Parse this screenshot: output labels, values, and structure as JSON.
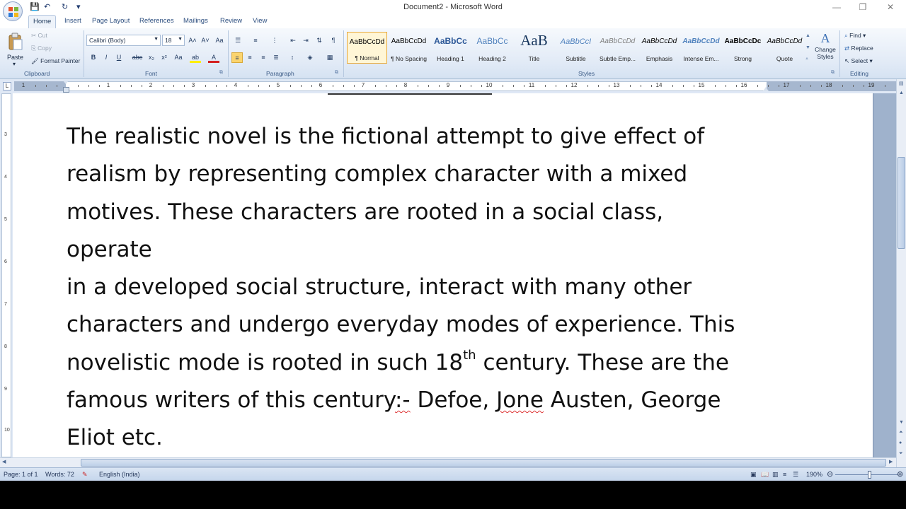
{
  "window": {
    "title": "Document2 - Microsoft Word",
    "controls": {
      "minimize": "—",
      "restore": "❐",
      "close": "✕"
    }
  },
  "quick_access": {
    "save": "💾",
    "undo": "↶",
    "redo": "↻",
    "more": "▾"
  },
  "tabs": [
    "Home",
    "Insert",
    "Page Layout",
    "References",
    "Mailings",
    "Review",
    "View"
  ],
  "ribbon": {
    "clipboard": {
      "paste": "Paste",
      "cut": "Cut",
      "copy": "Copy",
      "format_painter": "Format Painter",
      "label": "Clipboard"
    },
    "font": {
      "name": "Calibri (Body)",
      "size": "18",
      "label": "Font",
      "grow": "A˄",
      "shrink": "A˅",
      "clear": "Aa",
      "bold": "B",
      "italic": "I",
      "underline": "U",
      "strike": "abc",
      "subscript": "x₂",
      "superscript": "x²",
      "case": "Aa",
      "highlight": "ab",
      "color": "A"
    },
    "paragraph": {
      "label": "Paragraph"
    },
    "styles": {
      "label": "Styles",
      "items": [
        {
          "sample": "AaBbCcDd",
          "name": "¶ Normal"
        },
        {
          "sample": "AaBbCcDd",
          "name": "¶ No Spacing"
        },
        {
          "sample": "AaBbCc",
          "name": "Heading 1"
        },
        {
          "sample": "AaBbCc",
          "name": "Heading 2"
        },
        {
          "sample": "AaB",
          "name": "Title"
        },
        {
          "sample": "AaBbCcI",
          "name": "Subtitle"
        },
        {
          "sample": "AaBbCcDd",
          "name": "Subtle Emp..."
        },
        {
          "sample": "AaBbCcDd",
          "name": "Emphasis"
        },
        {
          "sample": "AaBbCcDd",
          "name": "Intense Em..."
        },
        {
          "sample": "AaBbCcDc",
          "name": "Strong"
        },
        {
          "sample": "AaBbCcDd",
          "name": "Quote"
        }
      ],
      "change_styles": "Change Styles"
    },
    "editing": {
      "label": "Editing",
      "find": "Find",
      "replace": "Replace",
      "select": "Select"
    }
  },
  "ruler": {
    "numbers": [
      "1",
      "1",
      "2",
      "3",
      "4",
      "5",
      "6",
      "7",
      "8",
      "9",
      "10",
      "11",
      "12",
      "13",
      "14",
      "15",
      "16",
      "17",
      "18",
      "19"
    ],
    "vnumbers": [
      "3",
      "4",
      "5",
      "6",
      "7",
      "8",
      "9",
      "10"
    ]
  },
  "document": {
    "lines": [
      "The realistic novel is the fictional attempt to give effect of",
      "realism by representing complex character with a mixed",
      "motives. These characters are rooted in a social class, operate",
      "in a developed social structure, interact with many other",
      "characters and undergo everyday modes of experience. This"
    ],
    "line6_pre": "novelistic mode is rooted in such 18",
    "line6_sup": "th",
    "line6_post": " century. These are the",
    "line7_a": "famous writers of this century",
    "line7_sq1": ":-",
    "line7_b": " Defoe, ",
    "line7_sq2": "Jone",
    "line7_c": " Austen, George",
    "line8": "Eliot etc."
  },
  "status": {
    "page": "Page: 1 of 1",
    "words": "Words: 72",
    "language": "English (India)",
    "zoom": "190%"
  }
}
